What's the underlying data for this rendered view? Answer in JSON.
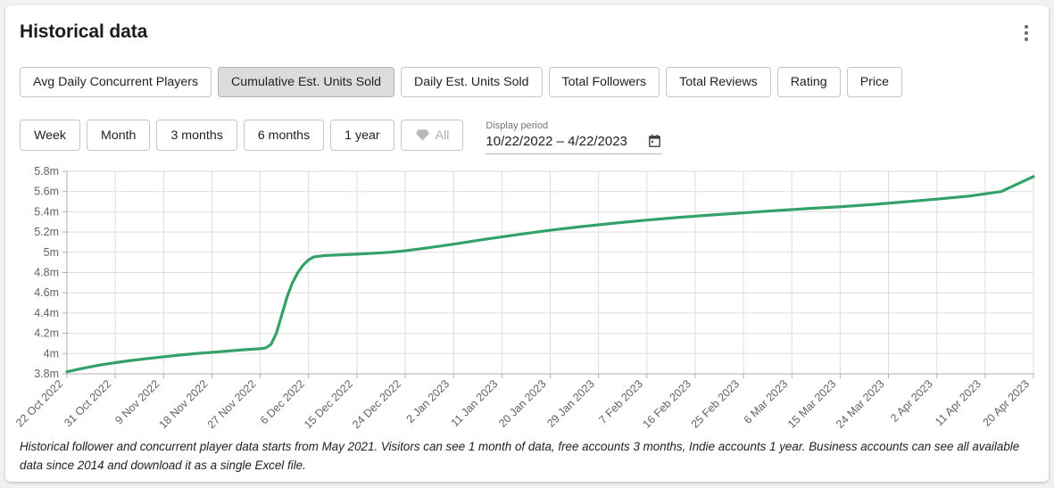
{
  "header": {
    "title": "Historical data",
    "menu_icon": "kebab-menu-icon"
  },
  "metric_tabs": [
    {
      "label": "Avg Daily Concurrent Players",
      "active": false
    },
    {
      "label": "Cumulative Est. Units Sold",
      "active": true
    },
    {
      "label": "Daily Est. Units Sold",
      "active": false
    },
    {
      "label": "Total Followers",
      "active": false
    },
    {
      "label": "Total Reviews",
      "active": false
    },
    {
      "label": "Rating",
      "active": false
    },
    {
      "label": "Price",
      "active": false
    }
  ],
  "period_buttons": [
    {
      "label": "Week",
      "disabled": false
    },
    {
      "label": "Month",
      "disabled": false
    },
    {
      "label": "3 months",
      "disabled": false
    },
    {
      "label": "6 months",
      "disabled": false
    },
    {
      "label": "1 year",
      "disabled": false
    },
    {
      "label": "All",
      "disabled": true,
      "icon": "gem-icon"
    }
  ],
  "display_period": {
    "label": "Display period",
    "value": "10/22/2022 – 4/22/2023",
    "icon": "calendar-icon"
  },
  "footer": {
    "note": "Historical follower and concurrent player data starts from May 2021. Visitors can see 1 month of data, free accounts 3 months, Indie accounts 1 year. Business accounts can see all available data since 2014 and download it as a single Excel file."
  },
  "colors": {
    "line": "#34a169",
    "grid": "#dddddd",
    "axis": "#b0b0b0",
    "tick_text": "#5f6368",
    "active_tab_bg": "#dcdcdc"
  },
  "chart_data": {
    "type": "line",
    "title": "Cumulative Est. Units Sold",
    "xlabel": "",
    "ylabel": "",
    "grid": true,
    "legend": false,
    "ylim": [
      3.8,
      5.8
    ],
    "y_unit": "m",
    "y_ticks": [
      3.8,
      4.0,
      4.2,
      4.4,
      4.6,
      4.8,
      5.0,
      5.2,
      5.4,
      5.6,
      5.8
    ],
    "y_tick_labels": [
      "3.8m",
      "4m",
      "4.2m",
      "4.4m",
      "4.6m",
      "4.8m",
      "5m",
      "5.2m",
      "5.4m",
      "5.6m",
      "5.8m"
    ],
    "x_tick_labels": [
      "22 Oct 2022",
      "31 Oct 2022",
      "9 Nov 2022",
      "18 Nov 2022",
      "27 Nov 2022",
      "6 Dec 2022",
      "15 Dec 2022",
      "24 Dec 2022",
      "2 Jan 2023",
      "11 Jan 2023",
      "20 Jan 2023",
      "29 Jan 2023",
      "7 Feb 2023",
      "16 Feb 2023",
      "25 Feb 2023",
      "6 Mar 2023",
      "15 Mar 2023",
      "24 Mar 2023",
      "2 Apr 2023",
      "11 Apr 2023",
      "20 Apr 2023"
    ],
    "x_tick_rotation": -45,
    "series": [
      {
        "name": "Cumulative Est. Units Sold",
        "color": "#34a169",
        "x": [
          0,
          3,
          6,
          9,
          12,
          15,
          18,
          21,
          24,
          27,
          30,
          33,
          36,
          37,
          38,
          39,
          40,
          41,
          42,
          43,
          44,
          45,
          46,
          48,
          51,
          54,
          57,
          60,
          63,
          66,
          72,
          78,
          84,
          90,
          96,
          102,
          108,
          114,
          120,
          126,
          132,
          138,
          144,
          150,
          156,
          162,
          168,
          174,
          180
        ],
        "values": [
          3.82,
          3.855,
          3.885,
          3.91,
          3.932,
          3.95,
          3.968,
          3.985,
          4.0,
          4.012,
          4.025,
          4.038,
          4.048,
          4.055,
          4.09,
          4.2,
          4.38,
          4.56,
          4.7,
          4.8,
          4.875,
          4.925,
          4.955,
          4.968,
          4.975,
          4.982,
          4.99,
          5.0,
          5.015,
          5.035,
          5.08,
          5.13,
          5.175,
          5.218,
          5.255,
          5.288,
          5.318,
          5.345,
          5.368,
          5.39,
          5.412,
          5.432,
          5.45,
          5.472,
          5.498,
          5.525,
          5.555,
          5.6,
          5.748
        ]
      }
    ]
  }
}
